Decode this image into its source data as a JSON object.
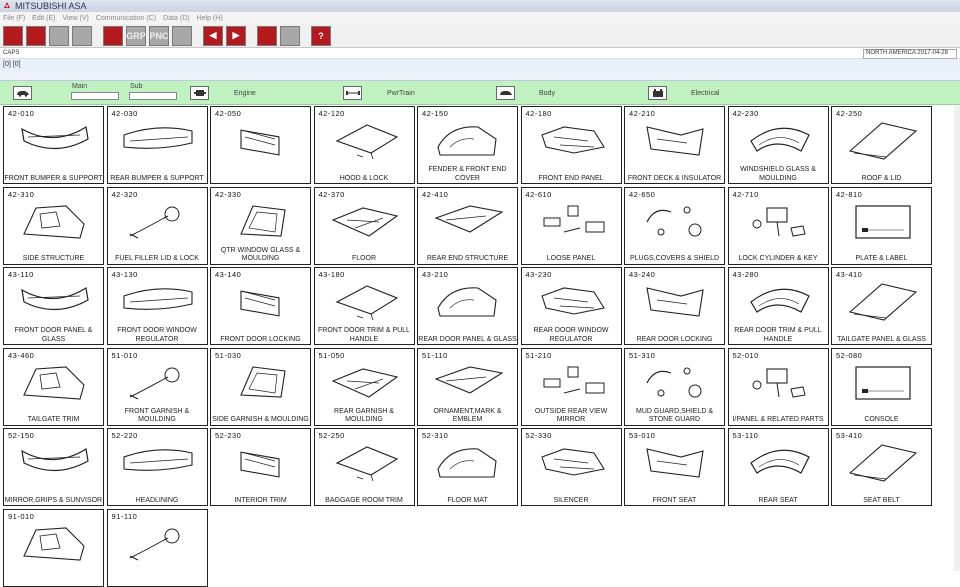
{
  "app": {
    "title": "MITSUBISHI ASA"
  },
  "menu": [
    "File (F)",
    "Edit (E)",
    "View (V)",
    "Communication (C)",
    "Data (D)",
    "Help (H)"
  ],
  "toolbar": [
    {
      "name": "exit-button",
      "text": "",
      "style": "red"
    },
    {
      "name": "print-button",
      "text": "",
      "style": "red"
    },
    {
      "name": "copy-button",
      "text": "",
      "style": "gray"
    },
    {
      "name": "image-button",
      "text": "",
      "style": "gray"
    },
    {
      "name": "record-button",
      "text": "",
      "style": "red"
    },
    {
      "name": "grp-button",
      "text": "GRP",
      "style": "gray"
    },
    {
      "name": "pnc-button",
      "text": "PNC",
      "style": "gray"
    },
    {
      "name": "split-button",
      "text": "",
      "style": "gray"
    },
    {
      "name": "back-button",
      "text": "◀",
      "style": "red"
    },
    {
      "name": "forward-button",
      "text": "▶",
      "style": "red"
    },
    {
      "name": "note-button",
      "text": "",
      "style": "red"
    },
    {
      "name": "tool-button",
      "text": "",
      "style": "gray"
    },
    {
      "name": "help-button",
      "text": "?",
      "style": "red"
    }
  ],
  "status": {
    "caps": "CAPS",
    "region": "NORTH AMERICA   2017-04-28"
  },
  "bracket": "[0] [0]",
  "category": {
    "main_label": "Main",
    "sub_label": "Sub",
    "engine": "Engine",
    "pwrtrain": "PwrTrain",
    "body": "Body",
    "electrical": "Electrical"
  },
  "parts": [
    {
      "code": "42-010",
      "label": "FRONT BUMPER & SUPPORT"
    },
    {
      "code": "42-030",
      "label": "REAR BUMPER & SUPPORT"
    },
    {
      "code": "42-050",
      "label": ""
    },
    {
      "code": "42-120",
      "label": "HOOD & LOCK"
    },
    {
      "code": "42-150",
      "label": "FENDER & FRONT END COVER"
    },
    {
      "code": "42-180",
      "label": "FRONT END PANEL"
    },
    {
      "code": "42-210",
      "label": "FRONT DECK & INSULATOR"
    },
    {
      "code": "42-230",
      "label": "WINDSHIELD GLASS & MOULDING"
    },
    {
      "code": "42-250",
      "label": "ROOF & LID"
    },
    {
      "code": "42-310",
      "label": "SIDE STRUCTURE"
    },
    {
      "code": "42-320",
      "label": "FUEL FILLER LID & LOCK"
    },
    {
      "code": "42-330",
      "label": "QTR WINDOW GLASS & MOULDING"
    },
    {
      "code": "42-370",
      "label": "FLOOR"
    },
    {
      "code": "42-410",
      "label": "REAR END STRUCTURE"
    },
    {
      "code": "42-610",
      "label": "LOOSE PANEL"
    },
    {
      "code": "42-650",
      "label": "PLUGS,COVERS & SHIELD"
    },
    {
      "code": "42-710",
      "label": "LOCK CYLINDER & KEY"
    },
    {
      "code": "42-810",
      "label": "PLATE & LABEL"
    },
    {
      "code": "43-110",
      "label": "FRONT DOOR PANEL & GLASS"
    },
    {
      "code": "43-130",
      "label": "FRONT DOOR WINDOW REGULATOR"
    },
    {
      "code": "43-140",
      "label": "FRONT DOOR LOCKING"
    },
    {
      "code": "43-180",
      "label": "FRONT DOOR TRIM & PULL HANDLE"
    },
    {
      "code": "43-210",
      "label": "REAR DOOR PANEL & GLASS"
    },
    {
      "code": "43-230",
      "label": "REAR DOOR WINDOW REGULATOR"
    },
    {
      "code": "43-240",
      "label": "REAR DOOR LOCKING"
    },
    {
      "code": "43-280",
      "label": "REAR DOOR TRIM & PULL HANDLE"
    },
    {
      "code": "43-410",
      "label": "TAILGATE PANEL & GLASS"
    },
    {
      "code": "43-460",
      "label": "TAILGATE TRIM"
    },
    {
      "code": "51-010",
      "label": "FRONT GARNISH & MOULDING"
    },
    {
      "code": "51-030",
      "label": "SIDE GARNISH & MOULDING"
    },
    {
      "code": "51-050",
      "label": "REAR GARNISH & MOULDING"
    },
    {
      "code": "51-110",
      "label": "ORNAMENT,MARK & EMBLEM"
    },
    {
      "code": "51-210",
      "label": "OUTSIDE REAR VIEW MIRROR"
    },
    {
      "code": "51-310",
      "label": "MUD GUARD,SHIELD & STONE GUARD"
    },
    {
      "code": "52-010",
      "label": "I/PANEL & RELATED PARTS"
    },
    {
      "code": "52-080",
      "label": "CONSOLE"
    },
    {
      "code": "52-150",
      "label": "MIRROR,GRIPS & SUNVISOR"
    },
    {
      "code": "52-220",
      "label": "HEADLINING"
    },
    {
      "code": "52-230",
      "label": "INTERIOR TRIM"
    },
    {
      "code": "52-250",
      "label": "BAGGAGE ROOM TRIM"
    },
    {
      "code": "52-310",
      "label": "FLOOR MAT"
    },
    {
      "code": "52-330",
      "label": "SILENCER"
    },
    {
      "code": "53-010",
      "label": "FRONT SEAT"
    },
    {
      "code": "53-110",
      "label": "REAR SEAT"
    },
    {
      "code": "53-410",
      "label": "SEAT BELT"
    },
    {
      "code": "91-010",
      "label": ""
    },
    {
      "code": "91-110",
      "label": ""
    }
  ]
}
